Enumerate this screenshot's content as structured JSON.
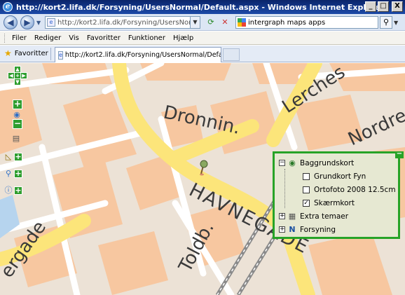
{
  "window": {
    "title": "http://kort2.lifa.dk/Forsyning/UsersNormal/Default.aspx - Windows Internet Explorer",
    "minimize": "_",
    "maximize": "□",
    "close": "X"
  },
  "addressbar": {
    "url": "http://kort2.lifa.dk/Forsyning/UsersNormal/Defa",
    "search_value": "intergraph maps apps"
  },
  "menu": [
    "Filer",
    "Rediger",
    "Vis",
    "Favoritter",
    "Funktioner",
    "Hjælp"
  ],
  "tabs": {
    "favorites_label": "Favoritter",
    "active_tab": "http://kort2.lifa.dk/Forsyning/UsersNormal/Default.aspx"
  },
  "map": {
    "street_labels": [
      "Dronnin.",
      "Lerches",
      "Nordre",
      "HAVNEGADE",
      "Toldb.",
      "ergade"
    ]
  },
  "layers": {
    "items": [
      {
        "label": "Baggrundskort",
        "expander": "−",
        "icon": "globe-icon"
      },
      {
        "label": "Grundkort Fyn",
        "checked": false
      },
      {
        "label": "Ortofoto 2008 12.5cm",
        "checked": false
      },
      {
        "label": "Skærmkort",
        "checked": true,
        "check_mark": "✓"
      },
      {
        "label": "Extra temaer",
        "expander": "+",
        "icon": "grid-icon"
      },
      {
        "label": "Forsyning",
        "expander": "+",
        "icon": "n-logo-icon"
      }
    ]
  },
  "colors": {
    "control_green": "#2f9e2f",
    "road_yellow": "#fce57a",
    "building_orange": "#f7c7a0"
  }
}
